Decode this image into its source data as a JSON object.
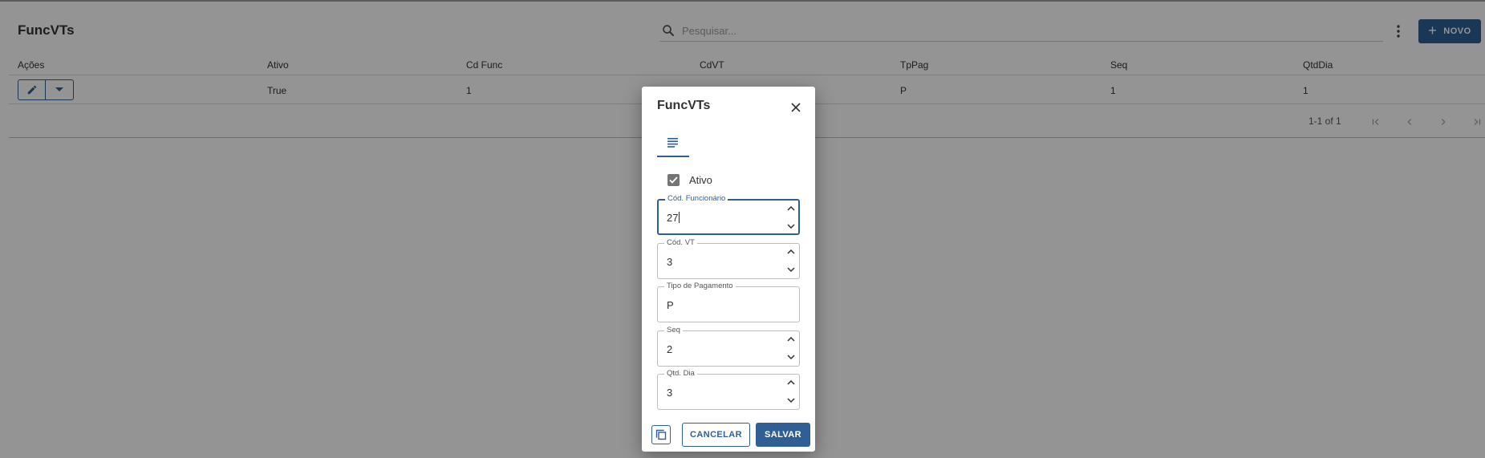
{
  "page": {
    "title": "FuncVTs",
    "search": {
      "placeholder": "Pesquisar..."
    },
    "new_button_label": "NOVO"
  },
  "table": {
    "columns": [
      "Ações",
      "Ativo",
      "Cd Func",
      "CdVT",
      "TpPag",
      "Seq",
      "QtdDia"
    ],
    "rows": [
      {
        "ativo": "True",
        "cd_func": "1",
        "cd_vt": "",
        "tp_pag": "P",
        "seq": "1",
        "qtd_dia": "1"
      }
    ],
    "pagination_text": "1-1 of 1"
  },
  "dialog": {
    "title": "FuncVTs",
    "checkbox": {
      "label": "Ativo",
      "checked": true
    },
    "fields": [
      {
        "label": "Cód. Funcionário",
        "value": "27",
        "type": "number",
        "focused": true
      },
      {
        "label": "Cód. VT",
        "value": "3",
        "type": "number"
      },
      {
        "label": "Tipo de Pagamento",
        "value": "P",
        "type": "text"
      },
      {
        "label": "Seq",
        "value": "2",
        "type": "number"
      },
      {
        "label": "Qtd. Dia",
        "value": "3",
        "type": "number"
      }
    ],
    "cancel_label": "CANCELAR",
    "save_label": "SALVAR"
  },
  "colors": {
    "accent": "#2f5f94",
    "overlay": "rgba(0,0,0,0.42)"
  },
  "icons": {
    "search": "search-icon",
    "more": "more-vert-icon",
    "add": "plus-icon",
    "edit": "pencil-icon",
    "dropdown": "caret-down-icon",
    "first_page": "first-page-icon",
    "prev_page": "chevron-left-icon",
    "next_page": "chevron-right-icon",
    "last_page": "last-page-icon",
    "close": "close-icon",
    "form_tab": "lines-icon",
    "copy": "copy-icon"
  }
}
